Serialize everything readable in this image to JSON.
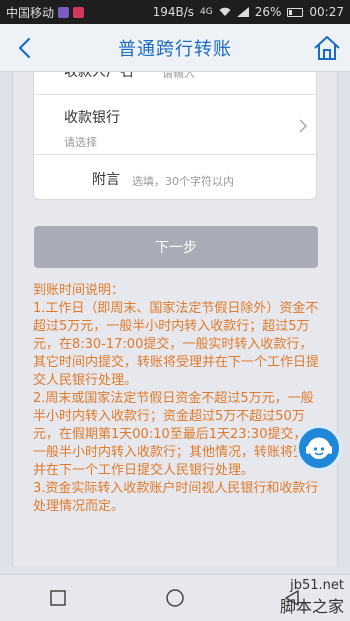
{
  "status_bar": {
    "carrier": "中国移动",
    "speed": "194B/s",
    "network": "4G",
    "battery": "26%",
    "time": "00:27"
  },
  "header": {
    "title": "普通跨行转账"
  },
  "form": {
    "name_label": "收款人户名",
    "name_placeholder": "请输入",
    "bank_label": "收款银行",
    "bank_placeholder": "请选择",
    "message_label": "附言",
    "message_placeholder": "选填，30个字符以内"
  },
  "next_button": "下一步",
  "info": {
    "title": "到账时间说明：",
    "items": [
      "1.工作日（即周末、国家法定节假日除外）资金不超过5万元，一般半小时内转入收款行；超过5万元，在8:30-17:00提交，一般实时转入收款行，其它时间内提交，转账将受理并在下一个工作日提交人民银行处理。",
      "2.周末或国家法定节假日资金不超过5万元，一般半小时内转入收款行；资金超过5万不超过50万元，在假期第1天00:10至最后1天23:30提交，一般半小时内转入收款行；其他情况，转账将受理并在下一个工作日提交人民银行处理。",
      "3.资金实际转入收款账户时间视人民银行和收款行处理情况而定。"
    ]
  },
  "watermark": {
    "site": "jb51.net",
    "name": "脚本之家"
  },
  "colors": {
    "title": "#1a6bc4",
    "info_text": "#e07a2a",
    "button_disabled": "#a9acb6",
    "float_button": "#1f86d9"
  },
  "icons": [
    "back-arrow-icon",
    "home-icon",
    "chevron-right-icon",
    "customer-service-icon",
    "nav-back-icon",
    "nav-home-icon",
    "nav-recent-icon"
  ]
}
